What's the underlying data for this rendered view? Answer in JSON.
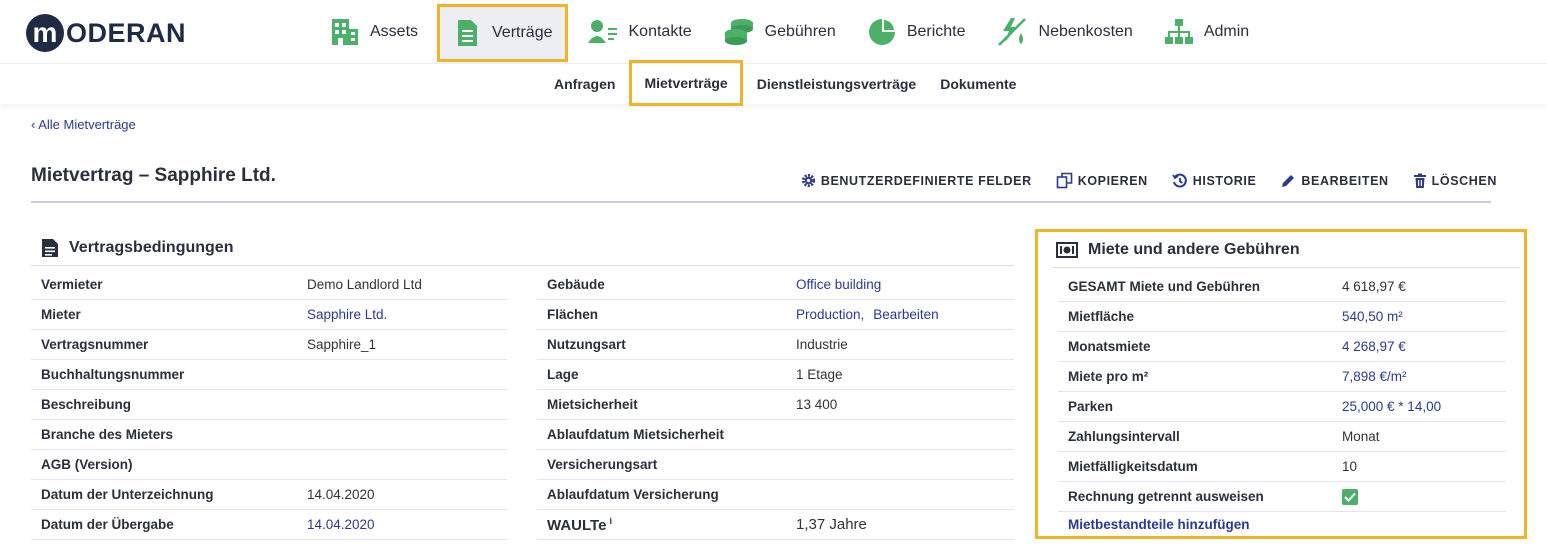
{
  "brand": {
    "logo_letter": "m",
    "logo_text": "ODERAN"
  },
  "main_nav": [
    {
      "label": "Assets",
      "icon": "building-icon"
    },
    {
      "label": "Verträge",
      "icon": "document-icon",
      "active": true
    },
    {
      "label": "Kontakte",
      "icon": "contacts-icon"
    },
    {
      "label": "Gebühren",
      "icon": "coins-icon"
    },
    {
      "label": "Berichte",
      "icon": "pie-chart-icon"
    },
    {
      "label": "Nebenkosten",
      "icon": "utilities-icon"
    },
    {
      "label": "Admin",
      "icon": "org-chart-icon"
    }
  ],
  "sub_nav": [
    {
      "label": "Anfragen"
    },
    {
      "label": "Mietverträge",
      "active": true
    },
    {
      "label": "Dienstleistungsverträge"
    },
    {
      "label": "Dokumente"
    }
  ],
  "back_link": "‹ Alle Mietverträge",
  "page_title": "Mietvertrag – Sapphire Ltd.",
  "actions": [
    {
      "label": "BENUTZERDEFINIERTE FELDER",
      "icon": "gear-icon"
    },
    {
      "label": "KOPIEREN",
      "icon": "copy-icon"
    },
    {
      "label": "HISTORIE",
      "icon": "history-icon"
    },
    {
      "label": "BEARBEITEN",
      "icon": "pencil-icon"
    },
    {
      "label": "LÖSCHEN",
      "icon": "trash-icon"
    }
  ],
  "terms": {
    "title": "Vertragsbedingungen",
    "left": [
      {
        "k": "Vermieter",
        "v": "Demo Landlord Ltd"
      },
      {
        "k": "Mieter",
        "v": "Sapphire Ltd.",
        "link": true
      },
      {
        "k": "Vertragsnummer",
        "v": "Sapphire_1"
      },
      {
        "k": "Buchhaltungsnummer",
        "v": ""
      },
      {
        "k": "Beschreibung",
        "v": ""
      },
      {
        "k": "Branche des Mieters",
        "v": ""
      },
      {
        "k": "AGB (Version)",
        "v": ""
      },
      {
        "k": "Datum der Unterzeichnung",
        "v": "14.04.2020"
      },
      {
        "k": "Datum der Übergabe",
        "v": "14.04.2020",
        "link": true
      }
    ],
    "right": [
      {
        "k": "Gebäude",
        "v": "Office building",
        "link": true
      },
      {
        "k": "Flächen",
        "v": "Production,",
        "v2": "Bearbeiten",
        "link": true
      },
      {
        "k": "Nutzungsart",
        "v": "Industrie"
      },
      {
        "k": "Lage",
        "v": "1 Etage"
      },
      {
        "k": "Mietsicherheit",
        "v": "13 400"
      },
      {
        "k": "Ablaufdatum Mietsicherheit",
        "v": ""
      },
      {
        "k": "Versicherungsart",
        "v": ""
      },
      {
        "k": "Ablaufdatum Versicherung",
        "v": ""
      }
    ],
    "waulte": {
      "k": "WAULTe",
      "sup": "i",
      "v": "1,37 Jahre"
    }
  },
  "rent": {
    "title": "Miete und andere Gebühren",
    "rows": [
      {
        "k": "GESAMT Miete und Gebühren",
        "v": "4 618,97 €"
      },
      {
        "k": "Mietfläche",
        "v": "540,50 m²",
        "link": true
      },
      {
        "k": "Monatsmiete",
        "v": "4 268,97 €",
        "link": true
      },
      {
        "k": "Miete pro m²",
        "v": "7,898 €/m²",
        "link": true
      },
      {
        "k": "Parken",
        "v": "25,000 € * 14,00",
        "link": true
      },
      {
        "k": "Zahlungsintervall",
        "v": "Monat"
      },
      {
        "k": "Mietfälligkeitsdatum",
        "v": "10"
      },
      {
        "k": "Rechnung getrennt ausweisen",
        "checkbox": true,
        "checked": true
      }
    ],
    "add_link": "Mietbestandteile hinzufügen"
  },
  "colors": {
    "accent_green": "#4caf6a",
    "highlight": "#f0b429",
    "link": "#2b3a8f",
    "text_dark": "#2a2f3d"
  }
}
